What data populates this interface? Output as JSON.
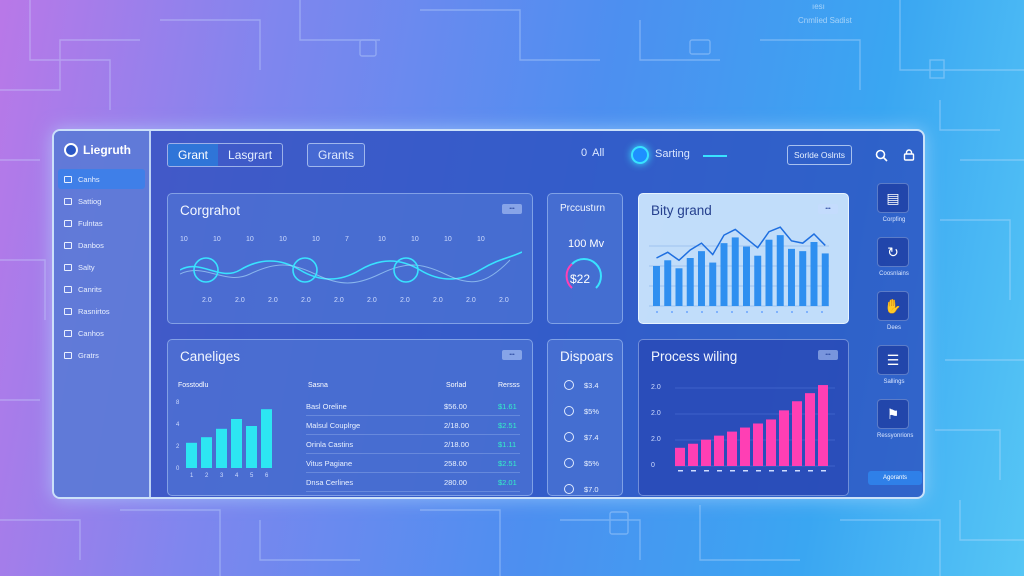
{
  "colors": {
    "accent": "#2f75d8",
    "cyan": "#39e2ff",
    "pink": "#ff3fb4",
    "green": "#34f0c8"
  },
  "background": {
    "top_right_label_1": "ıesı",
    "top_right_label_2": "Cnmlied Sadist"
  },
  "sidebar": {
    "brand": "Liegruth",
    "items": [
      {
        "label": "Canhs",
        "icon": "chart-icon",
        "active": true
      },
      {
        "label": "Sattiog",
        "icon": "gear-icon"
      },
      {
        "label": "Fulntas",
        "icon": "list-icon"
      },
      {
        "label": "Danbos",
        "icon": "folder-icon"
      },
      {
        "label": "Salty",
        "icon": "chart-icon"
      },
      {
        "label": "Canrits",
        "icon": "grid-icon"
      },
      {
        "label": "Rasnirtos",
        "icon": "document-icon"
      },
      {
        "label": "Canhos",
        "icon": "chart-icon"
      },
      {
        "label": "Gratrs",
        "icon": "user-icon"
      }
    ]
  },
  "topbar": {
    "tabs": [
      "Grant",
      "Lasgrart"
    ],
    "tab2": "Grants",
    "filter_label": "All",
    "filter_count": "0",
    "sorting_label": "Sarting",
    "search_button": "Sorlde Oslnts",
    "search_icon": "search-icon",
    "lock_icon": "lock-icon"
  },
  "cards": {
    "congrahot": {
      "title": "Corgrahot",
      "chip": "•••",
      "top_ticks": [
        "10",
        "10",
        "10",
        "10",
        "10",
        "7",
        "10",
        "10",
        "10",
        "10"
      ],
      "bottom_ticks": [
        "2.0",
        "2.0",
        "2.0",
        "2.0",
        "2.0",
        "2.0",
        "2.0",
        "2.0",
        "2.0",
        "2.0"
      ]
    },
    "precustration": {
      "title": "Prccustırn",
      "value1": "100 Mv",
      "value2": "$22"
    },
    "bity_grand": {
      "title": "Bity grand",
      "chip": "•••"
    },
    "caneliges": {
      "title": "Caneliges",
      "chip": "•••",
      "head": [
        "Fosstodlu",
        "Sasna",
        "Sorlad",
        "Rersss"
      ],
      "rows": [
        {
          "name": "Basl Oreline",
          "value": "$56.00",
          "delta": "$1.61"
        },
        {
          "name": "Malsul Couplrge",
          "value": "2/18.00",
          "delta": "$2.51"
        },
        {
          "name": "Orinla Castins",
          "value": "2/18.00",
          "delta": "$1.11"
        },
        {
          "name": "Vitus Pagiane",
          "value": "258.00",
          "delta": "$2.51"
        },
        {
          "name": "Dnsa Cerlines",
          "value": "280.00",
          "delta": "$2.01"
        }
      ],
      "y_ticks": [
        "8",
        "4",
        "2",
        "0"
      ],
      "x_ticks": [
        "1",
        "2",
        "3",
        "4",
        "5",
        "6"
      ]
    },
    "dispoars": {
      "title": "Dispoars",
      "rows": [
        "$3.4",
        "$5%",
        "$7.4",
        "$5%",
        "$7.0"
      ]
    },
    "process_wiling": {
      "title": "Process wiling",
      "chip": "•••",
      "y_ticks": [
        "2.0",
        "2.0",
        "2.0",
        "0"
      ]
    }
  },
  "right_rail": {
    "items": [
      {
        "label": "Corpfing",
        "icon": "bar-chart-icon"
      },
      {
        "label": "Coosnlains",
        "icon": "refresh-icon"
      },
      {
        "label": "Dees",
        "icon": "mouse-icon"
      },
      {
        "label": "Sallings",
        "icon": "list-icon"
      },
      {
        "label": "Ressyonrions",
        "icon": "person-icon"
      }
    ],
    "button": "Agorants"
  },
  "chart_data": [
    {
      "type": "bar",
      "title": "",
      "values": [
        18,
        22,
        28,
        35,
        30,
        42
      ]
    },
    {
      "type": "bar",
      "title": "",
      "values": [
        35,
        40,
        33,
        42,
        48,
        38,
        55,
        60,
        52,
        44,
        58,
        62,
        50,
        48,
        56,
        46
      ]
    },
    {
      "type": "bar",
      "title": "",
      "values": [
        18,
        22,
        26,
        30,
        34,
        38,
        42,
        46,
        55,
        64,
        72,
        80
      ]
    }
  ]
}
